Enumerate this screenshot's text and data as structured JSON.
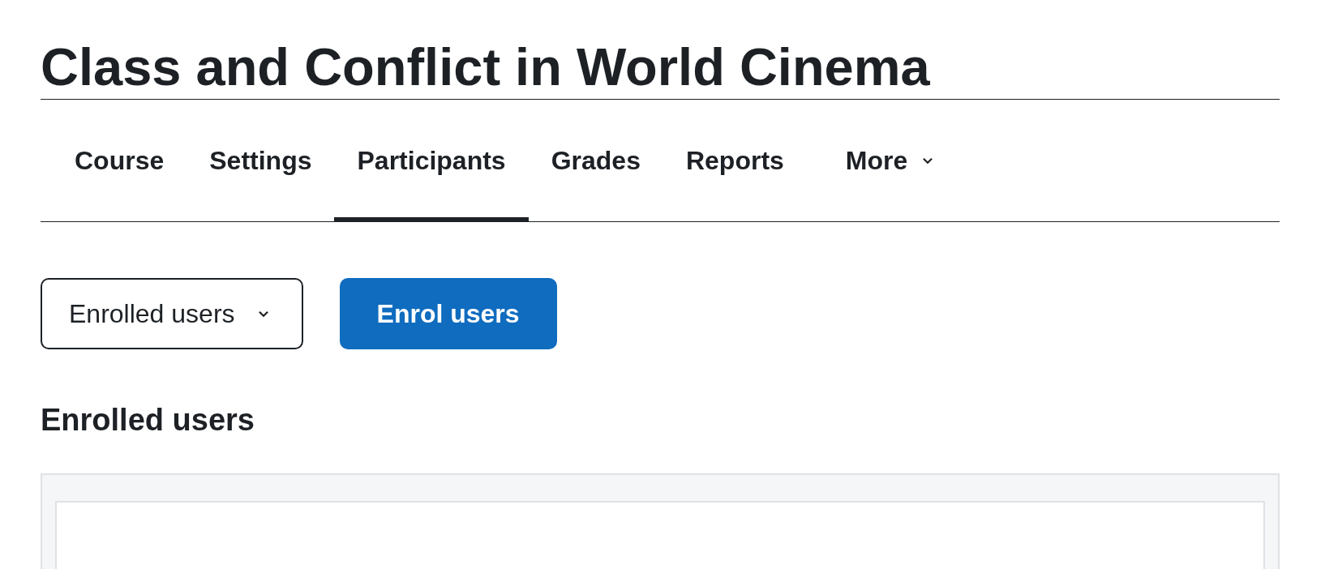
{
  "page_title": "Class and Conflict in World Cinema",
  "tabs": [
    {
      "label": "Course",
      "selected": false,
      "kind": "link"
    },
    {
      "label": "Settings",
      "selected": false,
      "kind": "link"
    },
    {
      "label": "Participants",
      "selected": true,
      "kind": "link"
    },
    {
      "label": "Grades",
      "selected": false,
      "kind": "link"
    },
    {
      "label": "Reports",
      "selected": false,
      "kind": "link"
    },
    {
      "label": "More",
      "selected": false,
      "kind": "menu"
    }
  ],
  "view_select": {
    "value": "Enrolled users"
  },
  "enrol_button": {
    "label": "Enrol users"
  },
  "section_heading": "Enrolled users"
}
